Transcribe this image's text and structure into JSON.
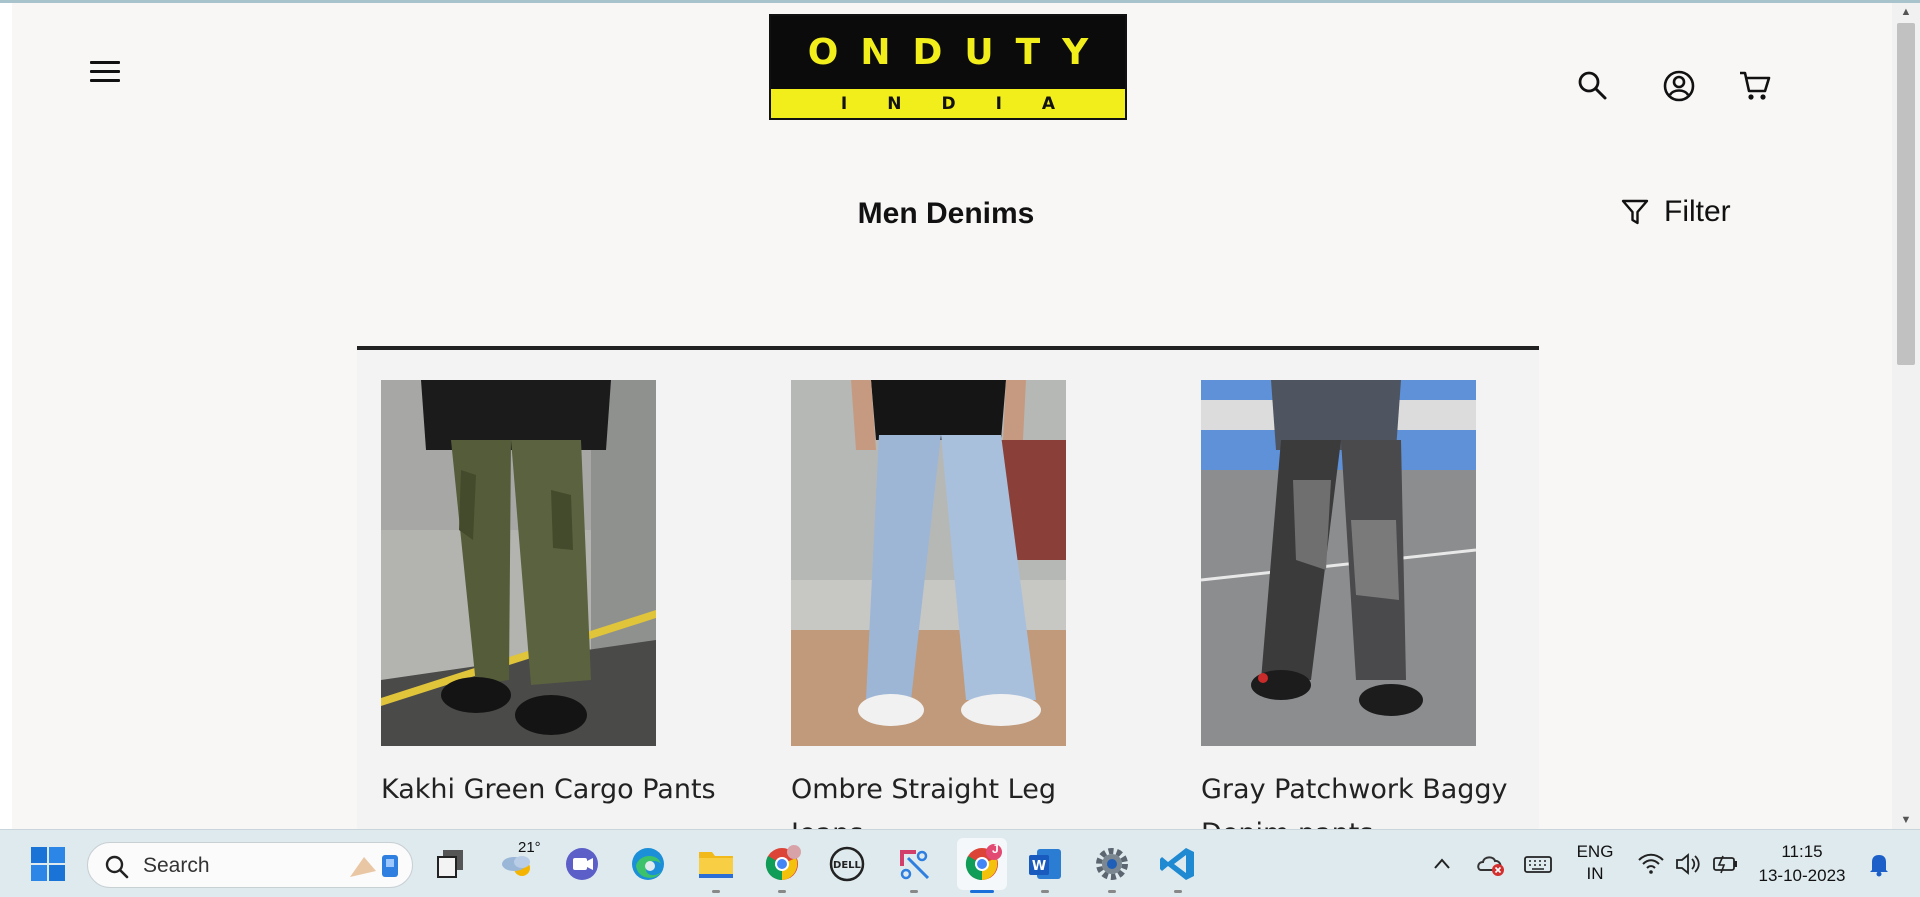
{
  "brand": {
    "line1": "ONDUTY",
    "line2": "INDIA",
    "colors": {
      "yellow": "#f2ee1c",
      "black": "#0b0b0b"
    }
  },
  "header": {
    "menu_icon": "hamburger-menu-icon",
    "icons": [
      "search-icon",
      "account-icon",
      "cart-icon"
    ]
  },
  "collection": {
    "title": "Men Denims",
    "filter_label": "Filter"
  },
  "products": [
    {
      "title": "Kakhi Green Cargo Pants"
    },
    {
      "title": "Ombre Straight Leg Jeans"
    },
    {
      "title": "Gray Patchwork Baggy Denim pants - StreetStyle"
    }
  ],
  "taskbar": {
    "search_placeholder": "Search",
    "weather_temp": "21°",
    "chrome_badge": "J",
    "language_line1": "ENG",
    "language_line2": "IN",
    "time": "11:15",
    "date": "13-10-2023"
  }
}
